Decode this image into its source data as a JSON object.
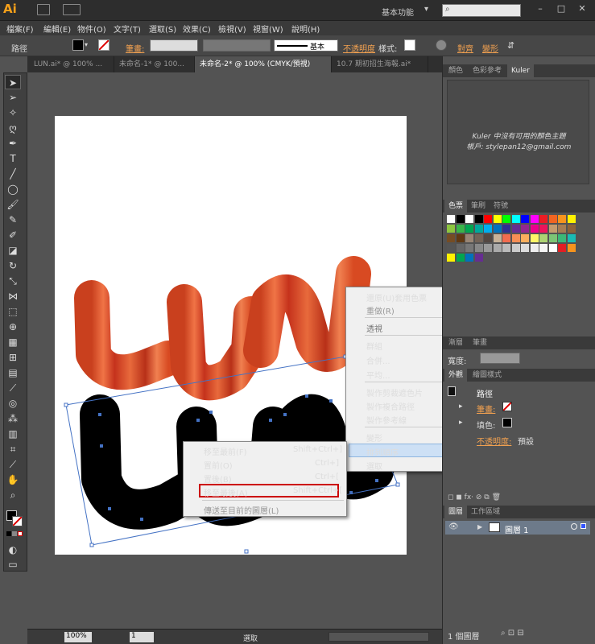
{
  "app": {
    "logo": "Ai",
    "workspace": "基本功能"
  },
  "menu": [
    "檔案(F)",
    "編輯(E)",
    "物件(O)",
    "文字(T)",
    "選取(S)",
    "效果(C)",
    "檢視(V)",
    "視窗(W)",
    "說明(H)"
  ],
  "control": {
    "selection_type": "路徑",
    "stroke_label": "筆畫:",
    "stroke_style": "基本",
    "opacity_label": "不透明度",
    "style_label": "樣式:",
    "align_label": "對齊",
    "transform_label": "變形"
  },
  "doc_tabs": [
    "LUN.ai* @ 100% ...",
    "未命名-1* @ 100...",
    "未命名-2* @ 100% (CMYK/預視)",
    "10.7 期初招生海報.ai*"
  ],
  "status": {
    "zoom": "100%",
    "page": "1",
    "mode": "選取"
  },
  "panels": {
    "color_tabs": [
      "顏色",
      "色彩參考",
      "Kuler"
    ],
    "kuler_msg1": "Kuler 中沒有可用的顏色主題",
    "kuler_msg2": "帳戶: stylepan12@gmail.com",
    "swatch_tabs": [
      "色票",
      "筆刷",
      "符號"
    ],
    "stroke_tabs": [
      "漸層",
      "筆畫"
    ],
    "stroke_weight_label": "寬度:",
    "appearance_tabs": [
      "外觀",
      "繪圖樣式"
    ],
    "appearance_title": "路徑",
    "appearance_stroke": "筆畫:",
    "appearance_fill": "填色:",
    "appearance_opacity_label": "不透明度:",
    "appearance_opacity_value": "預設",
    "layers_tabs": [
      "圖層",
      "工作區域"
    ],
    "layer_name": "圖層 1",
    "layers_count": "1 個圖層"
  },
  "context_menu": {
    "items": [
      {
        "label": "還原(U)套用色票",
        "disabled": false
      },
      {
        "label": "重做(R)",
        "disabled": true
      },
      {
        "label": "透視",
        "disabled": false,
        "sub": true
      },
      {
        "label": "群組",
        "disabled": false
      },
      {
        "label": "合併...",
        "disabled": false
      },
      {
        "label": "平均...",
        "disabled": false
      },
      {
        "label": "製作剪裁遮色片",
        "disabled": false
      },
      {
        "label": "製作複合路徑",
        "disabled": false
      },
      {
        "label": "製作參考線",
        "disabled": false
      },
      {
        "label": "變形",
        "disabled": false,
        "sub": true
      },
      {
        "label": "排列順序",
        "disabled": false,
        "sub": true
      },
      {
        "label": "選取",
        "disabled": false,
        "sub": true
      }
    ]
  },
  "submenu": {
    "items": [
      {
        "label": "移至最前(F)",
        "shortcut": "Shift+Ctrl+]"
      },
      {
        "label": "置前(O)",
        "shortcut": "Ctrl+]"
      },
      {
        "label": "置後(B)",
        "shortcut": "Ctrl+["
      },
      {
        "label": "移至最後(A)",
        "shortcut": "Shift+Ctrl+["
      },
      {
        "label": "傳送至目前的圖層(L)",
        "shortcut": ""
      }
    ]
  },
  "colors": {
    "accent_orange": "#f0a050",
    "highlight": "#cc0000"
  }
}
